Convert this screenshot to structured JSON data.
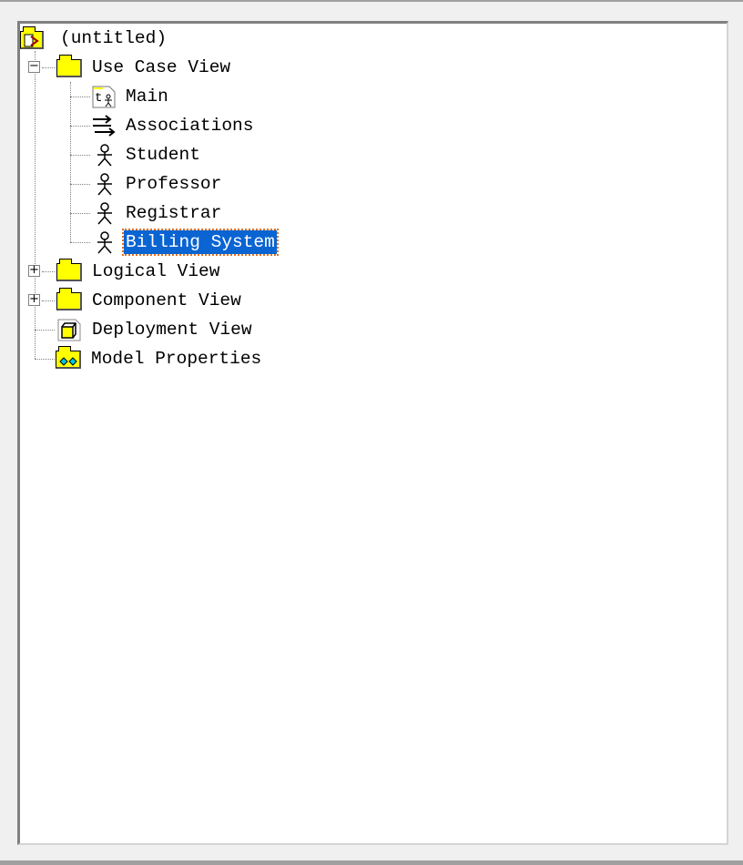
{
  "tree": {
    "root": {
      "label": "(untitled)",
      "icon": "model-icon"
    },
    "use_case_view": {
      "label": "Use Case View",
      "icon": "folder-icon",
      "expanded": true,
      "children": [
        {
          "label": "Main",
          "icon": "use-case-diagram-icon"
        },
        {
          "label": "Associations",
          "icon": "associations-icon"
        },
        {
          "label": "Student",
          "icon": "actor-icon"
        },
        {
          "label": "Professor",
          "icon": "actor-icon"
        },
        {
          "label": "Registrar",
          "icon": "actor-icon"
        },
        {
          "label": "Billing System",
          "icon": "actor-icon",
          "selected": true
        }
      ]
    },
    "logical_view": {
      "label": "Logical View",
      "icon": "folder-icon",
      "expanded": false
    },
    "component_view": {
      "label": "Component View",
      "icon": "folder-icon",
      "expanded": false
    },
    "deployment_view": {
      "label": "Deployment View",
      "icon": "deployment-icon"
    },
    "model_properties": {
      "label": "Model Properties",
      "icon": "properties-folder-icon"
    }
  },
  "colors": {
    "selection": "#0a64d2",
    "folder": "#ffff00"
  }
}
